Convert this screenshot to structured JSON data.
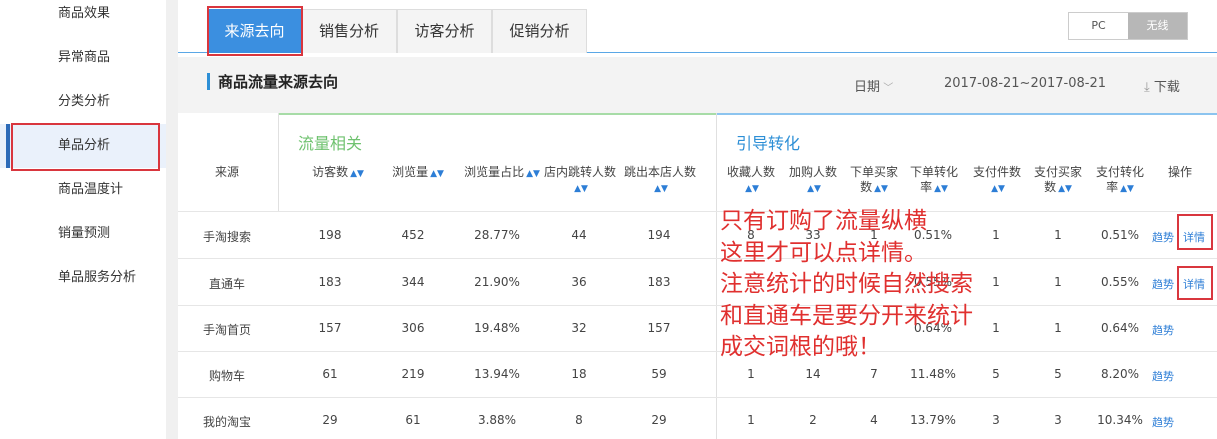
{
  "sidebar": {
    "items": [
      {
        "label": "商品效果"
      },
      {
        "label": "异常商品"
      },
      {
        "label": "分类分析"
      },
      {
        "label": "单品分析"
      },
      {
        "label": "商品温度计"
      },
      {
        "label": "销量预测"
      },
      {
        "label": "单品服务分析"
      }
    ]
  },
  "tabs": [
    {
      "label": "来源去向"
    },
    {
      "label": "销售分析"
    },
    {
      "label": "访客分析"
    },
    {
      "label": "促销分析"
    }
  ],
  "device_toggle": {
    "pc": "PC",
    "wireless": "无线"
  },
  "section": {
    "title": "商品流量来源去向",
    "date_label": "日期",
    "date_range": "2017-08-21~2017-08-21",
    "download": "下载"
  },
  "groups": {
    "traffic": "流量相关",
    "conversion": "引导转化"
  },
  "headers": {
    "source": "来源",
    "visitors": "访客数",
    "pv": "浏览量",
    "pv_share": "浏览量占比",
    "internal_jump": "店内跳转人数",
    "exit": "跳出本店人数",
    "fav": "收藏人数",
    "cart": "加购人数",
    "order_buyers": "下单买家数",
    "order_rate": "下单转化率",
    "pay_items": "支付件数",
    "pay_buyers": "支付买家数",
    "pay_rate": "支付转化率",
    "ops": "操作"
  },
  "rows": [
    {
      "source": "手淘搜索",
      "visitors": "198",
      "pv": "452",
      "pv_share": "28.77%",
      "jump": "44",
      "exit": "194",
      "fav": "8",
      "cart": "33",
      "orders": "1",
      "order_rate": "0.51%",
      "pay_items": "1",
      "pay_buyers": "1",
      "pay_rate": "0.51%",
      "trend": "趋势",
      "detail": "详情"
    },
    {
      "source": "直通车",
      "visitors": "183",
      "pv": "344",
      "pv_share": "21.90%",
      "jump": "36",
      "exit": "183",
      "fav": "",
      "cart": "",
      "orders": "",
      "order_rate": "0.55%",
      "pay_items": "1",
      "pay_buyers": "1",
      "pay_rate": "0.55%",
      "trend": "趋势",
      "detail": "详情"
    },
    {
      "source": "手淘首页",
      "visitors": "157",
      "pv": "306",
      "pv_share": "19.48%",
      "jump": "32",
      "exit": "157",
      "fav": "",
      "cart": "",
      "orders": "",
      "order_rate": "0.64%",
      "pay_items": "1",
      "pay_buyers": "1",
      "pay_rate": "0.64%",
      "trend": "趋势",
      "detail": ""
    },
    {
      "source": "购物车",
      "visitors": "61",
      "pv": "219",
      "pv_share": "13.94%",
      "jump": "18",
      "exit": "59",
      "fav": "1",
      "cart": "14",
      "orders": "7",
      "order_rate": "11.48%",
      "pay_items": "5",
      "pay_buyers": "5",
      "pay_rate": "8.20%",
      "trend": "趋势",
      "detail": ""
    },
    {
      "source": "我的淘宝",
      "visitors": "29",
      "pv": "61",
      "pv_share": "3.88%",
      "jump": "8",
      "exit": "29",
      "fav": "1",
      "cart": "2",
      "orders": "4",
      "order_rate": "13.79%",
      "pay_items": "3",
      "pay_buyers": "3",
      "pay_rate": "10.34%",
      "trend": "趋势",
      "detail": ""
    }
  ],
  "annotation": {
    "lines": [
      "只有订购了流量纵横",
      "这里才可以点详情。",
      "注意统计的时候自然搜索",
      "和直通车是要分开来统计",
      "成交词根的哦！"
    ]
  },
  "colors": {
    "accent": "#3b8fe0",
    "annotation_red": "#e0302f",
    "traffic_green": "#8fd18f",
    "conversion_blue": "#2d8fd6"
  }
}
